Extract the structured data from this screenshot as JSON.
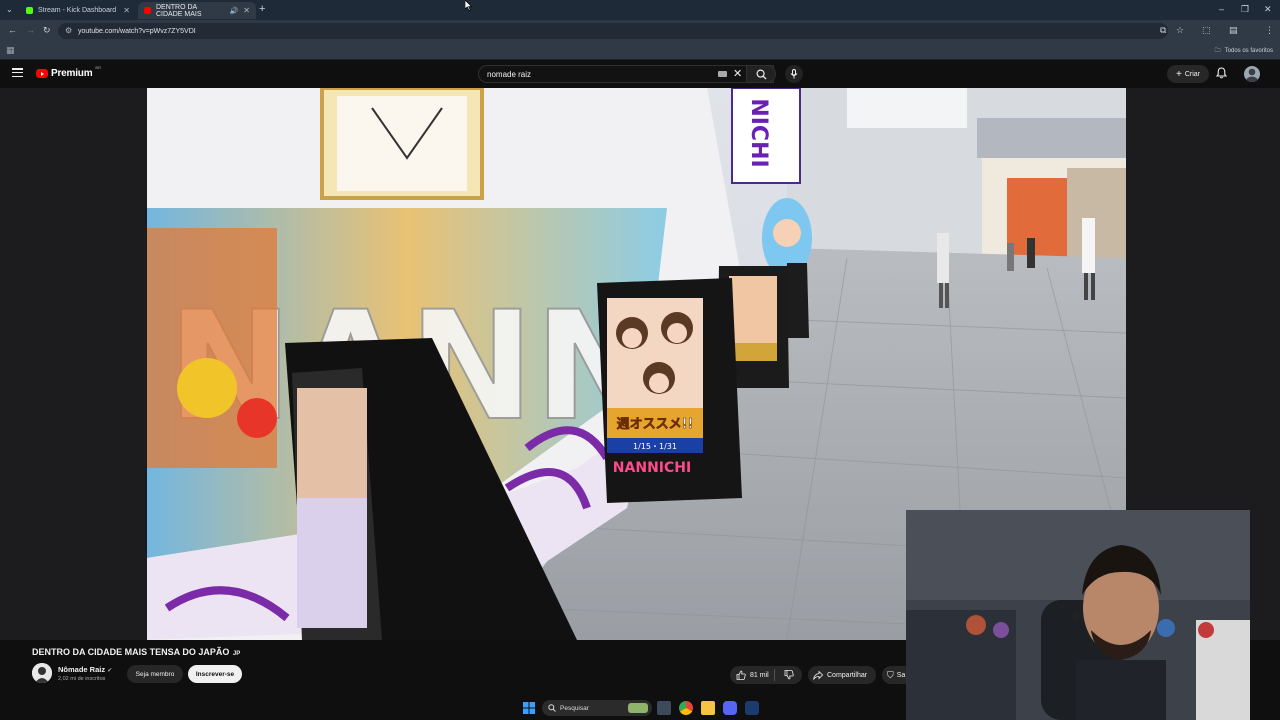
{
  "browser": {
    "tabs": [
      {
        "label": "Stream - Kick Dashboard",
        "color": "#53fc18"
      },
      {
        "label": "DENTRO DA CIDADE MAIS",
        "color": "#ff0000"
      }
    ],
    "url": "youtube.com/watch?v=pWvz7ZY5VDI",
    "bookmarks_label": "Todos os favoritos"
  },
  "youtube": {
    "logo_text": "Premium",
    "logo_suffix": "BR",
    "search_value": "nomade raiz",
    "create_label": "Criar"
  },
  "video": {
    "title": "DENTRO DA CIDADE MAIS TENSA DO JAPÃO",
    "title_suffix": "JP",
    "channel_name": "Nômade Raiz",
    "subscribers": "2,02 mi de inscritos",
    "join_label": "Seja membro",
    "subscribe_label": "Inscrever-se",
    "likes": "81 mil",
    "share_label": "Compartilhar",
    "save_label": "Sa",
    "sign_text": "NANNICHI",
    "poster_text": "週オススメ!!",
    "poster_date": "1/15・1/31",
    "banner_text": "NICHI"
  },
  "taskbar": {
    "search_placeholder": "Pesquisar"
  },
  "colors": {
    "youtube_red": "#ff0000",
    "kick_green": "#53fc18",
    "background": "#0f0f0f"
  }
}
